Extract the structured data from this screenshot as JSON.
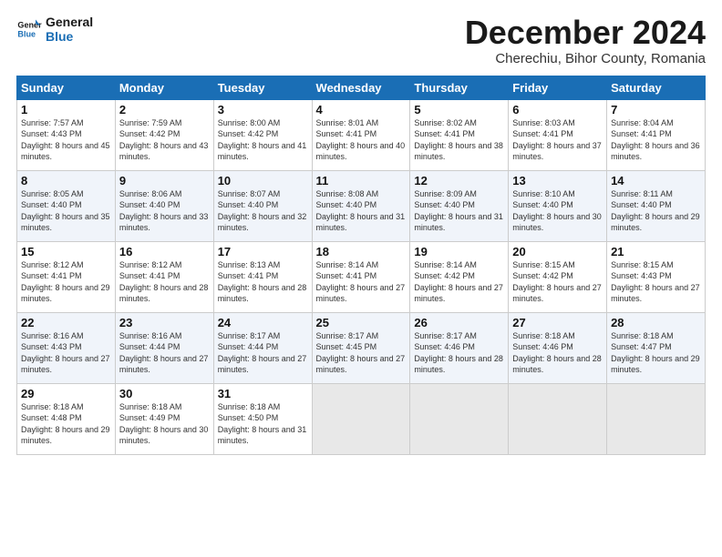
{
  "header": {
    "logo_line1": "General",
    "logo_line2": "Blue",
    "month": "December 2024",
    "location": "Cherechiu, Bihor County, Romania"
  },
  "days_of_week": [
    "Sunday",
    "Monday",
    "Tuesday",
    "Wednesday",
    "Thursday",
    "Friday",
    "Saturday"
  ],
  "weeks": [
    [
      {
        "num": "1",
        "sunrise": "7:57 AM",
        "sunset": "4:43 PM",
        "daylight": "8 hours and 45 minutes."
      },
      {
        "num": "2",
        "sunrise": "7:59 AM",
        "sunset": "4:42 PM",
        "daylight": "8 hours and 43 minutes."
      },
      {
        "num": "3",
        "sunrise": "8:00 AM",
        "sunset": "4:42 PM",
        "daylight": "8 hours and 41 minutes."
      },
      {
        "num": "4",
        "sunrise": "8:01 AM",
        "sunset": "4:41 PM",
        "daylight": "8 hours and 40 minutes."
      },
      {
        "num": "5",
        "sunrise": "8:02 AM",
        "sunset": "4:41 PM",
        "daylight": "8 hours and 38 minutes."
      },
      {
        "num": "6",
        "sunrise": "8:03 AM",
        "sunset": "4:41 PM",
        "daylight": "8 hours and 37 minutes."
      },
      {
        "num": "7",
        "sunrise": "8:04 AM",
        "sunset": "4:41 PM",
        "daylight": "8 hours and 36 minutes."
      }
    ],
    [
      {
        "num": "8",
        "sunrise": "8:05 AM",
        "sunset": "4:40 PM",
        "daylight": "8 hours and 35 minutes."
      },
      {
        "num": "9",
        "sunrise": "8:06 AM",
        "sunset": "4:40 PM",
        "daylight": "8 hours and 33 minutes."
      },
      {
        "num": "10",
        "sunrise": "8:07 AM",
        "sunset": "4:40 PM",
        "daylight": "8 hours and 32 minutes."
      },
      {
        "num": "11",
        "sunrise": "8:08 AM",
        "sunset": "4:40 PM",
        "daylight": "8 hours and 31 minutes."
      },
      {
        "num": "12",
        "sunrise": "8:09 AM",
        "sunset": "4:40 PM",
        "daylight": "8 hours and 31 minutes."
      },
      {
        "num": "13",
        "sunrise": "8:10 AM",
        "sunset": "4:40 PM",
        "daylight": "8 hours and 30 minutes."
      },
      {
        "num": "14",
        "sunrise": "8:11 AM",
        "sunset": "4:40 PM",
        "daylight": "8 hours and 29 minutes."
      }
    ],
    [
      {
        "num": "15",
        "sunrise": "8:12 AM",
        "sunset": "4:41 PM",
        "daylight": "8 hours and 29 minutes."
      },
      {
        "num": "16",
        "sunrise": "8:12 AM",
        "sunset": "4:41 PM",
        "daylight": "8 hours and 28 minutes."
      },
      {
        "num": "17",
        "sunrise": "8:13 AM",
        "sunset": "4:41 PM",
        "daylight": "8 hours and 28 minutes."
      },
      {
        "num": "18",
        "sunrise": "8:14 AM",
        "sunset": "4:41 PM",
        "daylight": "8 hours and 27 minutes."
      },
      {
        "num": "19",
        "sunrise": "8:14 AM",
        "sunset": "4:42 PM",
        "daylight": "8 hours and 27 minutes."
      },
      {
        "num": "20",
        "sunrise": "8:15 AM",
        "sunset": "4:42 PM",
        "daylight": "8 hours and 27 minutes."
      },
      {
        "num": "21",
        "sunrise": "8:15 AM",
        "sunset": "4:43 PM",
        "daylight": "8 hours and 27 minutes."
      }
    ],
    [
      {
        "num": "22",
        "sunrise": "8:16 AM",
        "sunset": "4:43 PM",
        "daylight": "8 hours and 27 minutes."
      },
      {
        "num": "23",
        "sunrise": "8:16 AM",
        "sunset": "4:44 PM",
        "daylight": "8 hours and 27 minutes."
      },
      {
        "num": "24",
        "sunrise": "8:17 AM",
        "sunset": "4:44 PM",
        "daylight": "8 hours and 27 minutes."
      },
      {
        "num": "25",
        "sunrise": "8:17 AM",
        "sunset": "4:45 PM",
        "daylight": "8 hours and 27 minutes."
      },
      {
        "num": "26",
        "sunrise": "8:17 AM",
        "sunset": "4:46 PM",
        "daylight": "8 hours and 28 minutes."
      },
      {
        "num": "27",
        "sunrise": "8:18 AM",
        "sunset": "4:46 PM",
        "daylight": "8 hours and 28 minutes."
      },
      {
        "num": "28",
        "sunrise": "8:18 AM",
        "sunset": "4:47 PM",
        "daylight": "8 hours and 29 minutes."
      }
    ],
    [
      {
        "num": "29",
        "sunrise": "8:18 AM",
        "sunset": "4:48 PM",
        "daylight": "8 hours and 29 minutes."
      },
      {
        "num": "30",
        "sunrise": "8:18 AM",
        "sunset": "4:49 PM",
        "daylight": "8 hours and 30 minutes."
      },
      {
        "num": "31",
        "sunrise": "8:18 AM",
        "sunset": "4:50 PM",
        "daylight": "8 hours and 31 minutes."
      },
      null,
      null,
      null,
      null
    ]
  ]
}
